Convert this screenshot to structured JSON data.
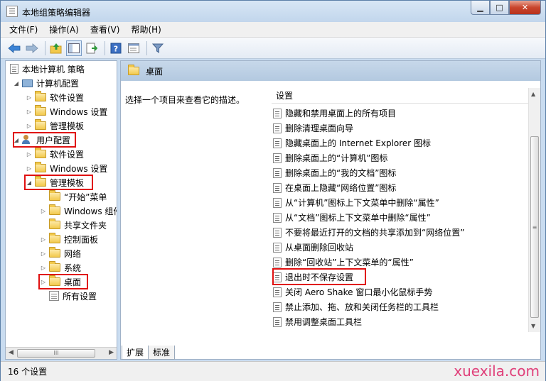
{
  "window": {
    "title": "本地组策略编辑器",
    "min": "▁",
    "max": "□",
    "close": "✕"
  },
  "menu": [
    "文件(F)",
    "操作(A)",
    "查看(V)",
    "帮助(H)"
  ],
  "toolbar_icons": [
    "back-arrow-icon",
    "forward-arrow-icon",
    "up-folder-icon",
    "show-hide-tree-icon",
    "export-list-icon",
    "help-icon",
    "properties-icon",
    "filter-icon"
  ],
  "tree": {
    "root": "本地计算机 策略",
    "computer_config": "计算机配置",
    "cc_software": "软件设置",
    "cc_windows": "Windows 设置",
    "cc_templates": "管理模板",
    "user_config": "用户配置",
    "uc_software": "软件设置",
    "uc_windows": "Windows 设置",
    "uc_templates": "管理模板",
    "start_menu": "“开始”菜单",
    "windows_components": "Windows 组件",
    "shared_folders": "共享文件夹",
    "control_panel": "控制面板",
    "network": "网络",
    "system": "系统",
    "desktop": "桌面",
    "all_settings": "所有设置",
    "hscroll_grip": "III"
  },
  "right": {
    "header_title": "桌面",
    "description": "选择一个项目来查看它的描述。",
    "column_header": "设置",
    "items": [
      "隐藏和禁用桌面上的所有项目",
      "删除清理桌面向导",
      "隐藏桌面上的 Internet Explorer 图标",
      "删除桌面上的“计算机”图标",
      "删除桌面上的“我的文档”图标",
      "在桌面上隐藏“网络位置”图标",
      "从“计算机”图标上下文菜单中删除“属性”",
      "从“文档”图标上下文菜单中删除“属性”",
      "不要将最近打开的文档的共享添加到“网络位置”",
      "从桌面删除回收站",
      "删除“回收站”上下文菜单的“属性”",
      "退出时不保存设置",
      "关闭 Aero Shake 窗口最小化鼠标手势",
      "禁止添加、拖、放和关闭任务栏的工具栏",
      "禁用调整桌面工具栏"
    ],
    "vscroll_grip": "≡"
  },
  "tabs": [
    "扩展",
    "标准"
  ],
  "status": "16 个设置",
  "watermark": "xuexila.com",
  "colors": {
    "highlight_box": "#e01010",
    "header_bg": "#b3c9e0",
    "watermark": "#e0407a"
  }
}
